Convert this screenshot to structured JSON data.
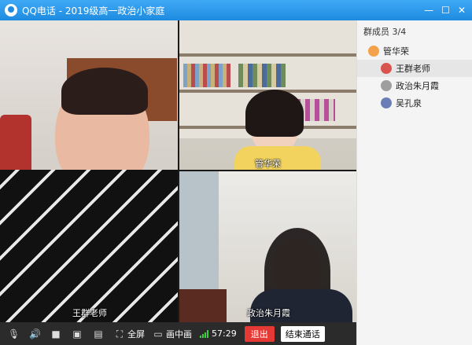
{
  "window": {
    "title": "QQ电话 - 2019级高一政治小家庭",
    "minimize_icon": "minimize-icon",
    "maximize_icon": "maximize-icon",
    "close_icon": "close-icon"
  },
  "videos": [
    {
      "label": "王群老师"
    },
    {
      "label": "管华荣"
    },
    {
      "label": "政治朱月霞"
    }
  ],
  "sidebar": {
    "header": "群成员 3/4",
    "members": [
      {
        "name": "管华荣",
        "avatar_color": "#f3a14a",
        "indent": false,
        "selected": false
      },
      {
        "name": "王群老师",
        "avatar_color": "#d9534f",
        "indent": true,
        "selected": true
      },
      {
        "name": "政治朱月霞",
        "avatar_color": "#9e9e9e",
        "indent": true,
        "selected": false
      },
      {
        "name": "吴孔泉",
        "avatar_color": "#6a7fb5",
        "indent": true,
        "selected": false
      }
    ]
  },
  "toolbar": {
    "fullscreen_label": "全屏",
    "pip_label": "画中画",
    "timer": "57:29",
    "exit_label": "退出",
    "end_call_label": "结束通话"
  },
  "colors": {
    "titlebar": "#1e8be0",
    "exit": "#e53935",
    "signal": "#3cd13c"
  }
}
